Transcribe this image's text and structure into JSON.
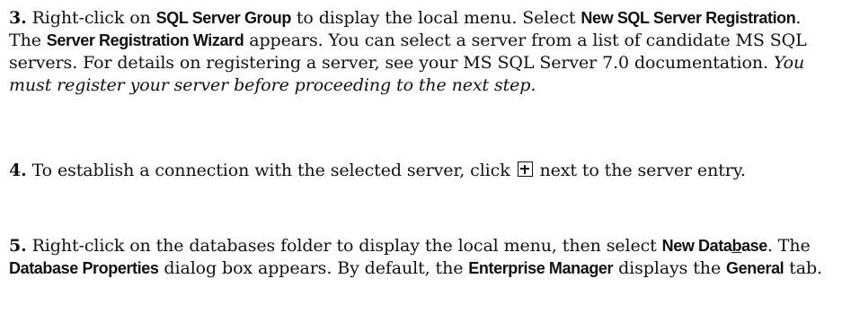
{
  "step3": {
    "number": "3.",
    "p1": " Right-click on ",
    "b1": "SQL Server Group",
    "p2": " to display the local menu. Select ",
    "b2": "New SQL Server Registration",
    "p3": ". The ",
    "b3": "Server Registration Wizard",
    "p4": " appears. You can select a server from a list of candidate MS SQL servers. For details on registering a server, see your MS SQL Server 7.0 documentation. ",
    "italic": "You must register your server before proceeding to the next step."
  },
  "step4": {
    "number": "4.",
    "p1": " To establish a connection with the selected server, click ",
    "icon": "plus-box-icon",
    "p2": " next to the server entry."
  },
  "step5": {
    "number": "5.",
    "p1": " Right-click on the databases folder to display the local menu, then select ",
    "b1_before": "New Data",
    "b1_underlined": "b",
    "b1_after": "ase",
    "p2": ". The ",
    "b2": "Database Properties",
    "p3": " dialog box appears. By default, the ",
    "b3": "Enterprise Manager",
    "p4": " displays the ",
    "b4": "General",
    "p5": " tab."
  }
}
